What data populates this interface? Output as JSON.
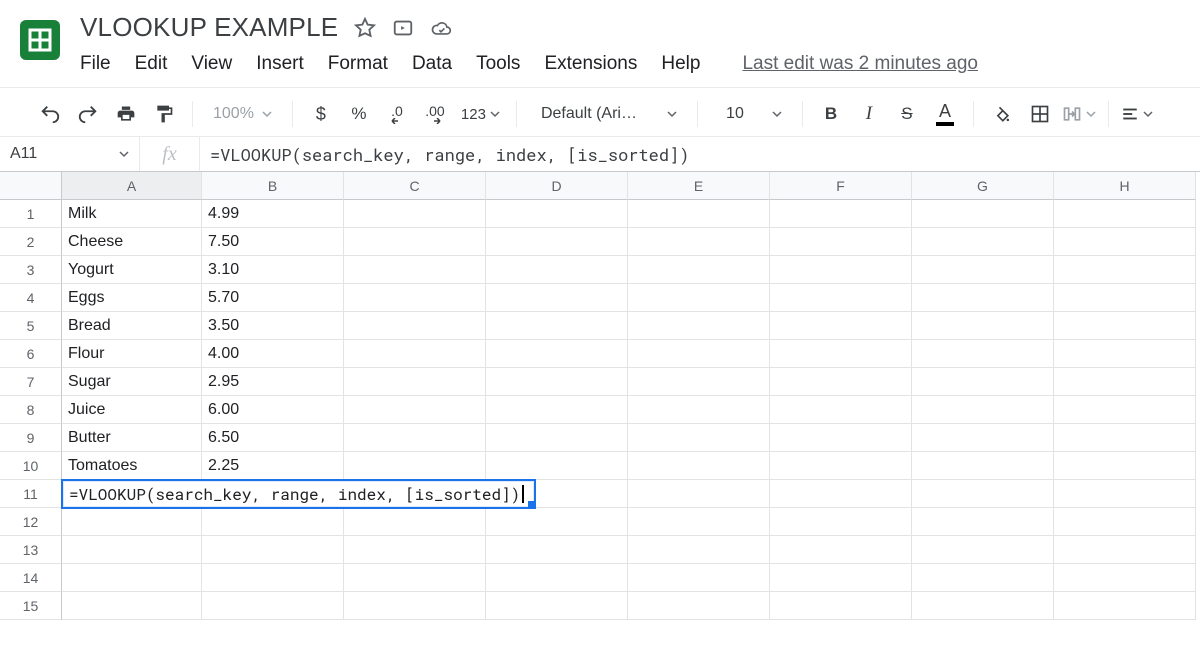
{
  "doc": {
    "title": "VLOOKUP EXAMPLE"
  },
  "menus": [
    "File",
    "Edit",
    "View",
    "Insert",
    "Format",
    "Data",
    "Tools",
    "Extensions",
    "Help"
  ],
  "last_edit": "Last edit was 2 minutes ago",
  "toolbar": {
    "zoom": "100%",
    "currency": "$",
    "percent": "%",
    "dec_less": ".0",
    "dec_more": ".00",
    "num_format": "123",
    "font_name": "Default (Ari…",
    "font_size": "10",
    "bold": "B",
    "italic": "I",
    "strike": "S",
    "text_color_letter": "A"
  },
  "name_box": "A11",
  "fx_label": "fx",
  "formula_bar": "=VLOOKUP(search_key, range, index, [is_sorted])",
  "columns": [
    "A",
    "B",
    "C",
    "D",
    "E",
    "F",
    "G",
    "H"
  ],
  "row_count": 15,
  "active_cell_formula": "=VLOOKUP(search_key, range, index, [is_sorted])",
  "cells": {
    "A1": "Milk",
    "B1": "4.99",
    "A2": "Cheese",
    "B2": "7.50",
    "A3": "Yogurt",
    "B3": "3.10",
    "A4": "Eggs",
    "B4": "5.70",
    "A5": "Bread",
    "B5": "3.50",
    "A6": "Flour",
    "B6": "4.00",
    "A7": "Sugar",
    "B7": "2.95",
    "A8": "Juice",
    "B8": "6.00",
    "A9": "Butter",
    "B9": "6.50",
    "A10": "Tomatoes",
    "B10": "2.25"
  },
  "active": {
    "row": 11,
    "col": "A"
  }
}
